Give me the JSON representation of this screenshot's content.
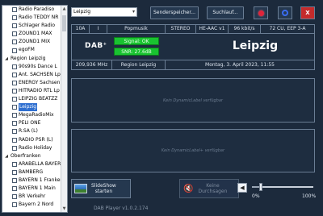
{
  "tree": {
    "items": [
      {
        "kind": "station",
        "label": "Radio Paradiso"
      },
      {
        "kind": "station",
        "label": "Radio TEDDY NR"
      },
      {
        "kind": "station",
        "label": "Schlager Radio"
      },
      {
        "kind": "station",
        "label": "ZOUND1 MAX"
      },
      {
        "kind": "station",
        "label": "ZOUND1 MIX"
      },
      {
        "kind": "station",
        "label": "egoFM"
      },
      {
        "kind": "group",
        "label": "Region Leipzig"
      },
      {
        "kind": "station",
        "label": "90s90s Dance L"
      },
      {
        "kind": "station",
        "label": "Ant. SACHSEN Lp"
      },
      {
        "kind": "station",
        "label": "ENERGY Sachsen"
      },
      {
        "kind": "station",
        "label": "HITRADIO RTL Lp"
      },
      {
        "kind": "station",
        "label": "LEIPZIG BEATZZ"
      },
      {
        "kind": "station",
        "label": "Leipzig",
        "selected": true
      },
      {
        "kind": "station",
        "label": "MegaRadioMix"
      },
      {
        "kind": "station",
        "label": "PELI ONE"
      },
      {
        "kind": "station",
        "label": "R.SA (L)"
      },
      {
        "kind": "station",
        "label": "RADIO PSR (L)"
      },
      {
        "kind": "station",
        "label": "Radio Holiday"
      },
      {
        "kind": "group",
        "label": "Oberfranken"
      },
      {
        "kind": "station",
        "label": "ARABELLA BAYERN"
      },
      {
        "kind": "station",
        "label": "BAMBERG"
      },
      {
        "kind": "station",
        "label": "BAYERN 1 Franken"
      },
      {
        "kind": "station",
        "label": "BAYERN 1 Main"
      },
      {
        "kind": "station",
        "label": "BR Verkehr"
      },
      {
        "kind": "station",
        "label": "Bayern 2 Nord"
      }
    ]
  },
  "toolbar": {
    "station_select": "Leipzig",
    "save_button": "Senderspeicher...",
    "scan_button": "Suchlauf...",
    "close_label": "X"
  },
  "info": {
    "channel": "10A",
    "mode": "I",
    "genre": "Popmusik",
    "audio": "STEREO",
    "codec": "HE-AAC v1",
    "bitrate": "96 kbit/s",
    "cu": "72 CU, EEP 3-A",
    "signal": "Signal: OK",
    "snr": "SNR: 27.6dB",
    "station_name": "Leipzig",
    "frequency": "209,936 MHz",
    "ensemble": "Region Leipzig",
    "datetime": "Montag, 3. April 2023, 11:55",
    "logo_text": "DAB",
    "logo_sup": "+"
  },
  "dls": {
    "text1": "Kein DynamicLabel verfügbar",
    "text2": "Kein DynamicLabel+ verfügbar"
  },
  "controls": {
    "slideshow_line1": "SlideShow",
    "slideshow_line2": "starten",
    "announce_line1": "Keine",
    "announce_line2": "Durchsagen",
    "volume_min": "0%",
    "volume_max": "100%",
    "volume_level": 0.15
  },
  "footer": {
    "version": "DAB Player v1.0.2.174"
  }
}
